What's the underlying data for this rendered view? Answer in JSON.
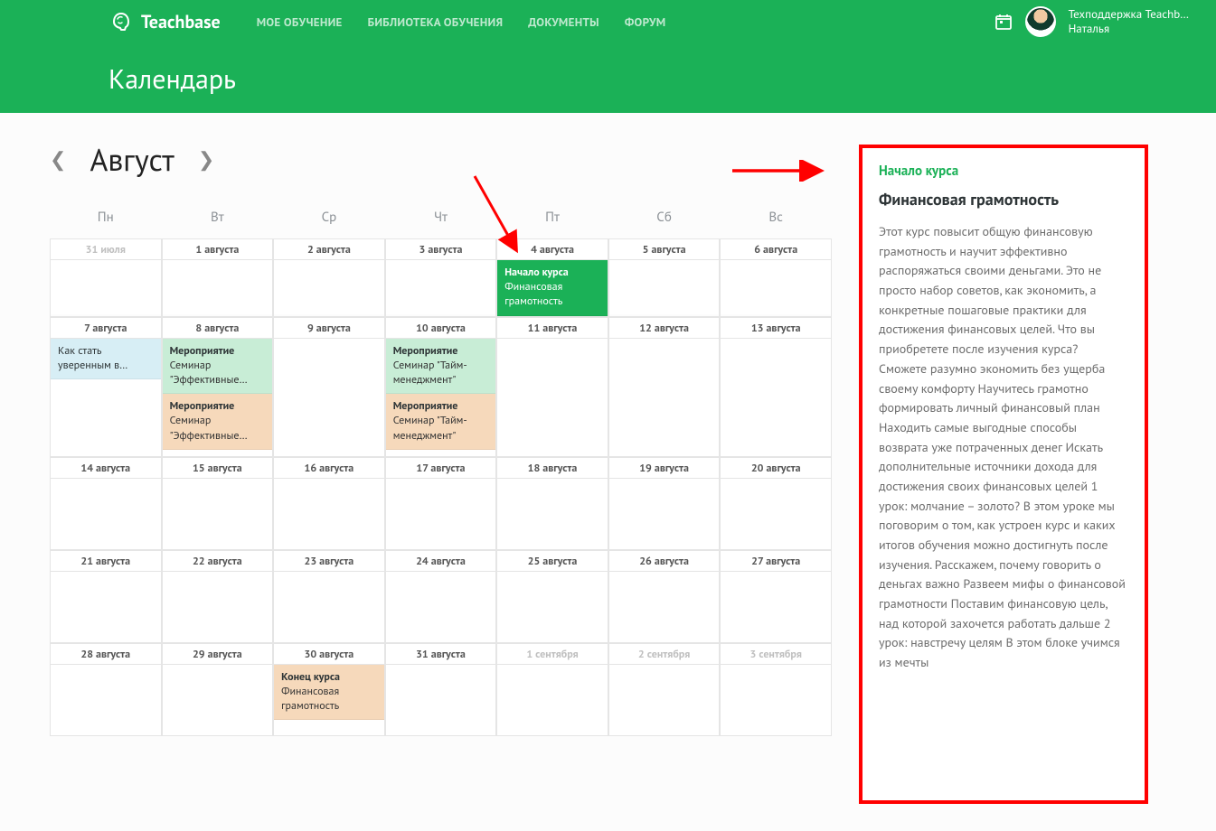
{
  "header": {
    "logo_text": "Teachbase",
    "nav": [
      "МОЕ ОБУЧЕНИЕ",
      "БИБЛИОТЕКА ОБУЧЕНИЯ",
      "ДОКУМЕНТЫ",
      "ФОРУМ"
    ],
    "user_line1": "Техподдержка Teachb…",
    "user_line2": "Наталья",
    "page_title": "Календарь"
  },
  "month": "Август",
  "weekdays": [
    "Пн",
    "Вт",
    "Ср",
    "Чт",
    "Пт",
    "Сб",
    "Вс"
  ],
  "dates": {
    "r1": [
      "31 июля",
      "1 августа",
      "2 августа",
      "3 августа",
      "4 августа",
      "5 августа",
      "6 августа"
    ],
    "r2": [
      "7 августа",
      "8 августа",
      "9 августа",
      "10 августа",
      "11 августа",
      "12 августа",
      "13 августа"
    ],
    "r3": [
      "14 августа",
      "15 августа",
      "16 августа",
      "17 августа",
      "18 августа",
      "19 августа",
      "20 августа"
    ],
    "r4": [
      "21 августа",
      "22 августа",
      "23 августа",
      "24 августа",
      "25 августа",
      "26 августа",
      "27 августа"
    ],
    "r5": [
      "28 августа",
      "29 августа",
      "30 августа",
      "31 августа",
      "1 сентября",
      "2 сентября",
      "3 сентября"
    ]
  },
  "events": {
    "start_course": {
      "title": "Начало курса",
      "sub": "Финансовая грамотность"
    },
    "confident": {
      "title": "Как стать уверенным в…",
      "sub": ""
    },
    "meropr_eff_1": {
      "title": "Мероприятие",
      "sub": "Семинар \"Эффективные…"
    },
    "meropr_eff_2": {
      "title": "Мероприятие",
      "sub": "Семинар \"Эффективные…"
    },
    "meropr_time_1": {
      "title": "Мероприятие",
      "sub": "Семинар \"Тайм-менеджмент\""
    },
    "meropr_time_2": {
      "title": "Мероприятие",
      "sub": "Семинар \"Тайм-менеджмент\""
    },
    "end_course": {
      "title": "Конец курса",
      "sub": "Финансовая грамотность"
    }
  },
  "side": {
    "label": "Начало курса",
    "title": "Финансовая грамотность",
    "desc": "Этот курс повысит общую финансовую грамотность и научит эффективно распоряжаться своими деньгами. Это не просто набор советов, как экономить, а конкретные пошаговые практики для достижения финансовых целей. Что вы приобретете после изучения курса? Сможете разумно экономить без ущерба своему комфорту Научитесь грамотно формировать личный финансовый план Находить самые выгодные способы возврата уже потраченных денег Искать дополнительные источники дохода для достижения своих финансовых целей 1 урок: молчание – золото? В этом уроке мы поговорим о том, как устроен курс и каких итогов обучения можно достигнуть после изучения. Расскажем, почему говорить о деньгах важно Развеем мифы о финансовой грамотности Поставим финансовую цель, над которой захочется работать дальше 2 урок: навстречу целям В этом блоке учимся из мечты"
  }
}
